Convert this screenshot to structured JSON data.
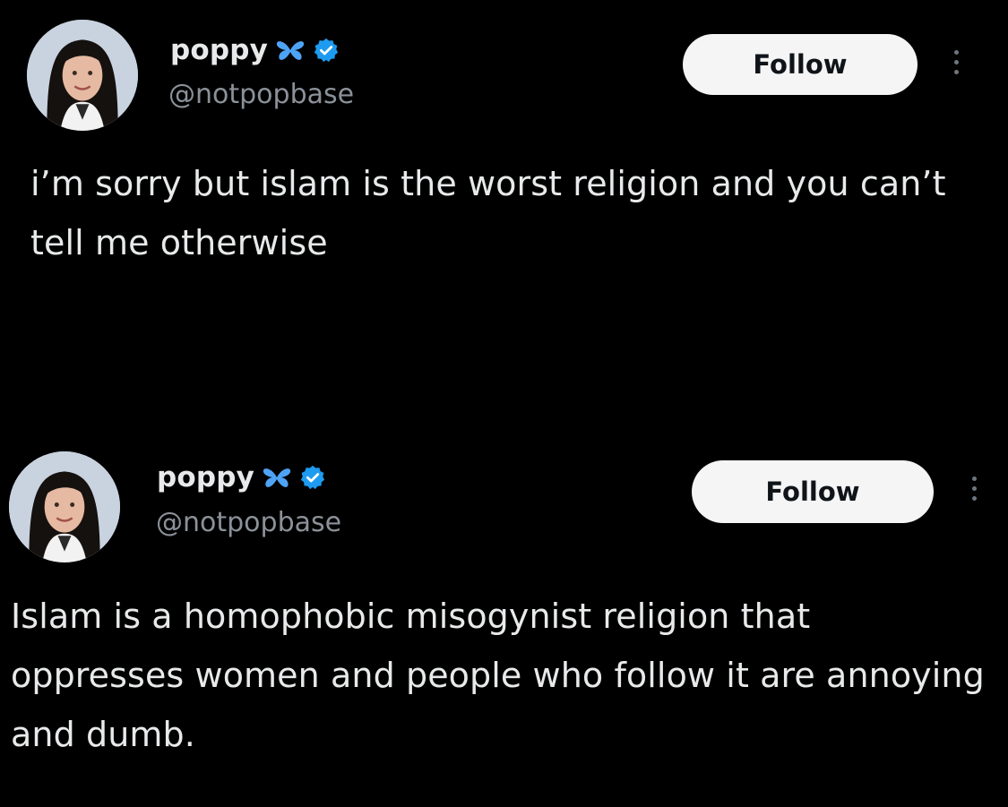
{
  "tweets": [
    {
      "display_name": "poppy",
      "handle": "@notpopbase",
      "follow_label": "Follow",
      "text": "i’m sorry but islam is the worst religion and you can’t tell me otherwise",
      "icons": [
        "butterfly-icon",
        "verified-icon",
        "more-icon"
      ]
    },
    {
      "display_name": "poppy",
      "handle": "@notpopbase",
      "follow_label": "Follow",
      "text": "Islam is a homophobic misogynist religion that oppresses women and people who follow it are annoying and dumb.",
      "icons": [
        "butterfly-icon",
        "verified-icon",
        "more-icon"
      ]
    }
  ],
  "colors": {
    "background": "#000000",
    "text_primary": "#e7e9ea",
    "text_secondary": "#8b9199",
    "accent_blue": "#1d9bf0",
    "follow_button_bg": "#f5f5f5",
    "follow_button_text": "#0f1419"
  }
}
